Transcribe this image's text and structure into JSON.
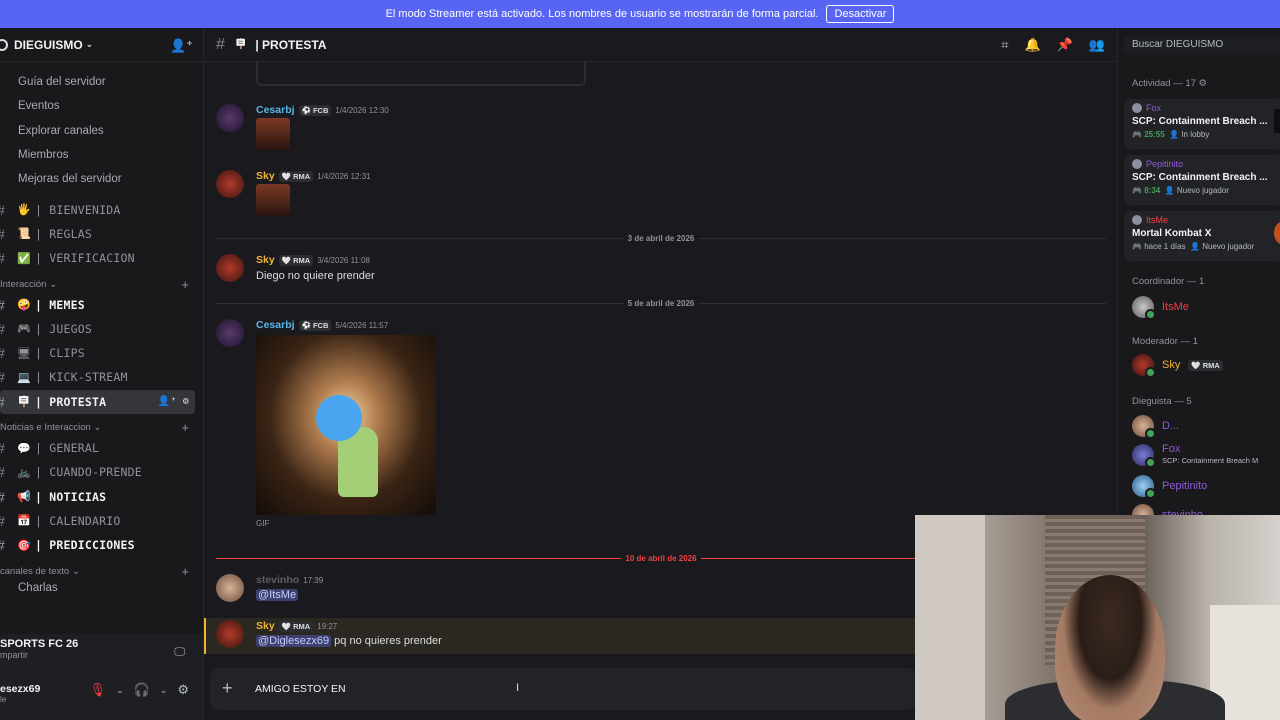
{
  "banner": {
    "text": "El modo Streamer está activado. Los nombres de usuario se mostrarán de forma parcial.",
    "button": "Desactivar"
  },
  "server": {
    "name": "DIEGUISMO"
  },
  "sidebar": {
    "nav": [
      "Guía del servidor",
      "Eventos",
      "Explorar canales",
      "Miembros",
      "Mejoras del servidor"
    ],
    "top_channels": [
      {
        "emoji": "🖐",
        "name": "| BIENVENIDA"
      },
      {
        "emoji": "📜",
        "name": "| REGLAS"
      },
      {
        "emoji": "✅",
        "name": "| VERIFICACION"
      }
    ],
    "cat1": "Interacción",
    "cat1_channels": [
      {
        "emoji": "🤪",
        "name": "| MEMES"
      },
      {
        "emoji": "🎮",
        "name": "| JUEGOS"
      },
      {
        "emoji": "🖥",
        "name": "| CLIPS"
      },
      {
        "emoji": "💻",
        "name": "| KICK-STREAM"
      },
      {
        "emoji": "🪧",
        "name": "| PROTESTA"
      }
    ],
    "cat2": "Noticias e Interaccion",
    "cat2_channels": [
      {
        "emoji": "💬",
        "name": "| GENERAL"
      },
      {
        "emoji": "🚲",
        "name": "| CUANDO-PRENDE"
      },
      {
        "emoji": "📢",
        "name": "| NOTICIAS"
      },
      {
        "emoji": "📅",
        "name": "| CALENDARIO"
      },
      {
        "emoji": "🎯",
        "name": "| PREDICCIONES"
      }
    ],
    "cat3": "canales de texto",
    "cat3_item": "Charlas",
    "voice_title": "SPORTS FC 26",
    "voice_sub": "mpartir",
    "user_name": "esezx69",
    "user_status": "le"
  },
  "channel": {
    "name": "| PROTESTA"
  },
  "messages": [
    {
      "user": "Cesarbj",
      "tag": "⚽ FCB",
      "time": "1/4/2026 12:30",
      "color": "#5bb6e8"
    },
    {
      "user": "Sky",
      "tag": "🤍 RMA",
      "time": "1/4/2026 12:31",
      "color": "#f0b232"
    },
    {
      "date": "3 de abril de 2026"
    },
    {
      "user": "Sky",
      "tag": "🤍 RMA",
      "time": "3/4/2026 11:08",
      "text": "Diego no quiere prender",
      "color": "#f0b232"
    },
    {
      "date": "5 de abril de 2026"
    },
    {
      "user": "Cesarbj",
      "tag": "⚽ FCB",
      "time": "5/4/2026 11:57",
      "gif_label": "GIF",
      "color": "#5bb6e8"
    },
    {
      "date": "10 de abril de 2026"
    },
    {
      "user": "stevinho",
      "time": "17:39",
      "mention": "@ItsMe",
      "color": "#5b5f6a"
    },
    {
      "user": "Sky",
      "tag": "🤍 RMA",
      "time": "19:27",
      "mention": "@Diglesezx69",
      "text": "pq no quieres prender",
      "color": "#f0b232"
    }
  ],
  "composer": {
    "text": "AMIGO ESTOY EN"
  },
  "members": {
    "search_placeholder": "Buscar DIEGUISMO",
    "activity_header": "Actividad — 17 ⚙",
    "activities": [
      {
        "who": "Fox",
        "game": "SCP: Containment Breach ...",
        "time": "25:55",
        "status": "In lobby"
      },
      {
        "who": "Pepitinito",
        "game": "SCP: Containment Breach ...",
        "time": "8:34",
        "status": "Nuevo jugador"
      },
      {
        "who": "ItsMe",
        "game": "Mortal Kombat X",
        "time": "hace 1 días",
        "status": "Nuevo jugador"
      }
    ],
    "coord_header": "Coordinador — 1",
    "coord": [
      {
        "name": "ItsMe",
        "color": "#f23f42"
      }
    ],
    "mod_header": "Moderador — 1",
    "mod": [
      {
        "name": "Sky",
        "tag": "🤍 RMA",
        "color": "#f0b232"
      }
    ],
    "dieg_header": "Dieguista — 5",
    "dieg": [
      {
        "name": "D...",
        "color": "#8f5bd6"
      },
      {
        "name": "Fox",
        "sub": "SCP: Containment Breach M",
        "color": "#8f5bd6"
      },
      {
        "name": "Pepitinito",
        "color": "#8f5bd6"
      },
      {
        "name": "stevinho",
        "color": "#8f5bd6"
      }
    ]
  }
}
